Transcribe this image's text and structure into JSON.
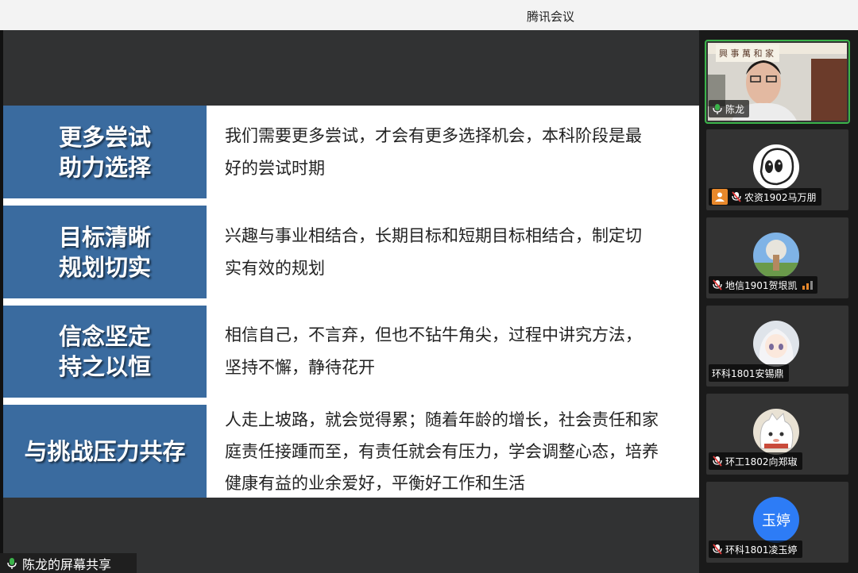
{
  "window": {
    "title": "腾讯会议"
  },
  "slide": {
    "rows": [
      {
        "label_lines": [
          "更多尝试",
          "助力选择"
        ],
        "text_lines": [
          "我们需要更多尝试，才会有更多选择机会，本科阶段是最",
          "好的尝试时期"
        ]
      },
      {
        "label_lines": [
          "目标清晰",
          "规划切实"
        ],
        "text_lines": [
          "兴趣与事业相结合，长期目标和短期目标相结合，制定切",
          "实有效的规划"
        ]
      },
      {
        "label_lines": [
          "信念坚定",
          "持之以恒"
        ],
        "text_lines": [
          "相信自己，不言弃，但也不钻牛角尖，过程中讲究方法，",
          "坚持不懈，静待花开"
        ]
      },
      {
        "label_lines": [
          "与挑战压力共存"
        ],
        "text_lines": [
          "人走上坡路，就会觉得累；随着年龄的增长，社会责任和家",
          "庭责任接踵而至，有责任就会有压力，学会调整心态，培养",
          "健康有益的业余爱好，平衡好工作和生活"
        ]
      }
    ]
  },
  "share_bar": {
    "label": "陈龙的屏幕共享"
  },
  "participants": [
    {
      "name": "陈龙",
      "active": true
    },
    {
      "name": "农资1902马万朋"
    },
    {
      "name": "地信1901贺垠凯"
    },
    {
      "name": "环科1801安锡鼎"
    },
    {
      "name": "环工1802向郑琡"
    },
    {
      "name": "环科1801凌玉婷",
      "avatar_text": "玉婷"
    }
  ],
  "colors": {
    "label_bg": "#3a6b9f",
    "avatar_blue": "#2d7cf6",
    "active_border": "#3bb34a",
    "accent_orange": "#e8882b"
  }
}
